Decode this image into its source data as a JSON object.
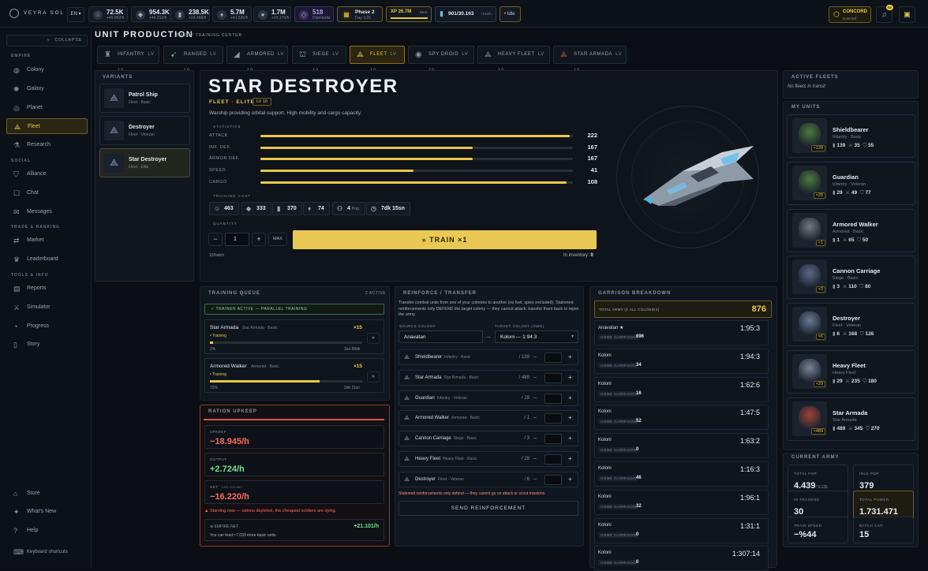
{
  "brand": "VEYRA SOL",
  "lang": "EN",
  "resources": [
    {
      "value": "72.5K",
      "rate": "+49.902/h",
      "icon": "people-icon"
    },
    {
      "value": "954.3K",
      "rate": "+46.212/h",
      "icon": "metal-icon"
    },
    {
      "value": "238.5K",
      "rate": "+24.468/h",
      "icon": "supply-icon"
    },
    {
      "value": "5.7M",
      "rate": "+41.536/h",
      "icon": "crystal-icon"
    },
    {
      "value": "1.7M",
      "rate": "+20.176/h",
      "icon": "food-icon"
    }
  ],
  "diamonds": {
    "value": "518",
    "label": "Diamonds"
  },
  "phase": {
    "title": "Phase 2",
    "sub": "Day 1/25"
  },
  "xp": {
    "value": "XP 26.7M",
    "max": "MAX",
    "fill": 1.0
  },
  "population": {
    "value": "901/30.163",
    "rate": "+144/h"
  },
  "idle": "Idle",
  "alliance": {
    "name": "CONCORD",
    "sub": "Concord"
  },
  "notif_count": "56",
  "sidebar": {
    "collapse": "COLLAPSE",
    "sections": [
      {
        "head": "EMPIRE",
        "items": [
          {
            "label": "Colony",
            "icon": "planet-icon"
          },
          {
            "label": "Galaxy",
            "icon": "galaxy-icon"
          },
          {
            "label": "Planet",
            "icon": "globe-icon"
          },
          {
            "label": "Fleet",
            "icon": "fleet-icon",
            "active": true
          },
          {
            "label": "Research",
            "icon": "flask-icon"
          }
        ]
      },
      {
        "head": "SOCIAL",
        "items": [
          {
            "label": "Alliance",
            "icon": "shield-icon"
          },
          {
            "label": "Chat",
            "icon": "chat-icon"
          },
          {
            "label": "Messages",
            "icon": "mail-icon"
          }
        ]
      },
      {
        "head": "TRADE & RANKING",
        "items": [
          {
            "label": "Market",
            "icon": "market-icon"
          },
          {
            "label": "Leaderboard",
            "icon": "trophy-icon"
          }
        ]
      },
      {
        "head": "TOOLS & INFO",
        "items": [
          {
            "label": "Reports",
            "icon": "report-icon"
          },
          {
            "label": "Simulator",
            "icon": "sim-icon"
          },
          {
            "label": "Progress",
            "icon": "progress-icon"
          },
          {
            "label": "Story",
            "icon": "book-icon"
          }
        ]
      }
    ],
    "bottom": [
      {
        "label": "Store",
        "icon": "store-icon"
      },
      {
        "label": "What's New",
        "icon": "news-icon"
      },
      {
        "label": "Help",
        "icon": "help-icon"
      },
      {
        "label": "Keyboard shortcuts",
        "icon": "keyboard-icon"
      }
    ]
  },
  "header": {
    "title": "UNIT PRODUCTION",
    "subtitle": "TROOP TRAINING CENTER"
  },
  "tabs": [
    {
      "label": "INFANTRY",
      "lv": "LV 10"
    },
    {
      "label": "RANGED",
      "lv": "LV 10"
    },
    {
      "label": "ARMORED",
      "lv": "LV 10"
    },
    {
      "label": "SIEGE",
      "lv": "LV 10"
    },
    {
      "label": "FLEET",
      "lv": "LV 10",
      "active": true
    },
    {
      "label": "SPY DROID",
      "lv": "LV 10"
    },
    {
      "label": "HEAVY FLEET",
      "lv": "LV 10"
    },
    {
      "label": "STAR ARMADA",
      "lv": "LV 10"
    }
  ],
  "variants_title": "VARIANTS",
  "variants": [
    {
      "name": "Patrol Ship",
      "sub": "Fleet · Basic"
    },
    {
      "name": "Destroyer",
      "sub": "Fleet · Veteran"
    },
    {
      "name": "Star Destroyer",
      "sub": "Fleet · Elite",
      "active": true
    }
  ],
  "unit": {
    "name": "STAR DESTROYER",
    "tag": "FLEET · ELITE",
    "lv": "LV 10",
    "desc": "Warship providing orbital support. High mobility and cargo capacity.",
    "stats_title": "STATISTICS",
    "stats": [
      {
        "label": "ATTACK",
        "value": "222",
        "fill": 0.99
      },
      {
        "label": "INF. DEF.",
        "value": "167",
        "fill": 0.68
      },
      {
        "label": "ARMOR DEF.",
        "value": "167",
        "fill": 0.68
      },
      {
        "label": "SPEED",
        "value": "41",
        "fill": 0.49
      },
      {
        "label": "CARGO",
        "value": "108",
        "fill": 0.98
      }
    ],
    "cost_title": "TRAINING COST",
    "costs": [
      {
        "value": "463",
        "icon": "people-icon"
      },
      {
        "value": "333",
        "icon": "metal-icon"
      },
      {
        "value": "370",
        "icon": "supply-icon"
      },
      {
        "value": "74",
        "icon": "crystal-icon"
      },
      {
        "value": "4",
        "suffix": "Pop.",
        "icon": "pop-icon"
      },
      {
        "value": "7dk 15sn",
        "icon": "clock-icon"
      }
    ],
    "qty_title": "QUANTITY",
    "qty": "1",
    "max": "MAX",
    "train": "TRAIN ×1",
    "batch": "15/batch",
    "inventory_label": "In inventory:",
    "inventory": "0"
  },
  "active_fleets": {
    "title": "ACTIVE FLEETS",
    "empty": "No fleets in transit"
  },
  "my_units": {
    "title": "MY UNITS",
    "items": [
      {
        "name": "Shieldbearer",
        "sub": "Infantry · Basic",
        "count": "×139",
        "a": "139",
        "b": "35",
        "c": "55"
      },
      {
        "name": "Guardian",
        "sub": "Infantry · Veteran",
        "count": "×29",
        "a": "29",
        "b": "49",
        "c": "77"
      },
      {
        "name": "Armored Walker",
        "sub": "Armored · Basic",
        "count": "×1",
        "a": "1",
        "b": "65",
        "c": "50"
      },
      {
        "name": "Cannon Carriage",
        "sub": "Siege · Basic",
        "count": "×3",
        "a": "3",
        "b": "110",
        "c": "80"
      },
      {
        "name": "Destroyer",
        "sub": "Fleet · Veteran",
        "count": "×6",
        "a": "6",
        "b": "168",
        "c": "126"
      },
      {
        "name": "Heavy Fleet",
        "sub": "Heavy Fleet",
        "count": "×29",
        "a": "29",
        "b": "235",
        "c": "180"
      },
      {
        "name": "Star Armada",
        "sub": "Star Armada",
        "count": "×489",
        "a": "489",
        "b": "345",
        "c": "270"
      }
    ]
  },
  "queue": {
    "title": "TRAINING QUEUE",
    "active": "2 ACTIVE",
    "banner": "TRAINER ACTIVE — PARALLEL TRAINING",
    "items": [
      {
        "name": "Star Armada",
        "sub": "Star Armada · Basic",
        "count": "×15",
        "status": "• Training",
        "pct": "2%",
        "fill": 0.02,
        "time": "3sa 58dk"
      },
      {
        "name": "Armored Walker",
        "sub": "Armored · Basic",
        "count": "×15",
        "status": "• Training",
        "pct": "72%",
        "fill": 0.72,
        "time": "2dk 11sn"
      }
    ]
  },
  "ration": {
    "title": "RATION UPKEEP",
    "upkeep_label": "UPKEEP",
    "upkeep": "−18.945/h",
    "output_label": "OUTPUT",
    "output": "+2.724/h",
    "net_label": "NET",
    "net_tag": "THIS COLONY",
    "net": "−16.220/h",
    "warning": "Starving now — rations depleted, the cheapest soldiers are dying.",
    "empire_label": "EMPIRE NET",
    "empire": "+21.101/h",
    "feed": "You can feed ≈7.033 more basic units"
  },
  "reinforce": {
    "title": "REINFORCE / TRANSFER",
    "desc": "Transfer combat units from one of your colonies to another (no fuel, spies excluded). Stationed reinforcements only DEFEND the target colony — they cannot attack; transfer them back to rejoin the army.",
    "source_label": "SOURCE COLONY",
    "source": "Anavatan",
    "target_label": "TARGET COLONY (OWN)",
    "target": "Koloni — 1:94:3",
    "rows": [
      {
        "name": "Shieldbearer",
        "sub": "Infantry · Basic",
        "count": "/ 139"
      },
      {
        "name": "Star Armada",
        "sub": "Star Armada · Basic",
        "count": "/ 489"
      },
      {
        "name": "Guardian",
        "sub": "Infantry · Veteran",
        "count": "/ 29"
      },
      {
        "name": "Armored Walker",
        "sub": "Armored · Basic",
        "count": "/ 1"
      },
      {
        "name": "Cannon Carriage",
        "sub": "Siege · Basic",
        "count": "/ 3"
      },
      {
        "name": "Heavy Fleet",
        "sub": "Heavy Fleet · Basic",
        "count": "/ 29"
      },
      {
        "name": "Destroyer",
        "sub": "Fleet · Veteran",
        "count": "/ 6"
      }
    ],
    "note": "Stationed reinforcements only defend — they cannot go on attack or scout missions.",
    "send": "SEND REINFORCEMENT"
  },
  "garrison": {
    "title": "GARRISON BREAKDOWN",
    "total_label": "TOTAL ARMY (Σ ALL COLONIES)",
    "total": "876",
    "hg": "HOME GARRISON",
    "rows": [
      {
        "name": "Anavatan ★",
        "coord": "1:95:3",
        "value": "696"
      },
      {
        "name": "Koloni",
        "coord": "1:94:3",
        "value": "34"
      },
      {
        "name": "Koloni",
        "coord": "1:62:6",
        "value": "16"
      },
      {
        "name": "Koloni",
        "coord": "1:47:5",
        "value": "52"
      },
      {
        "name": "Koloni",
        "coord": "1:63:2",
        "value": "0"
      },
      {
        "name": "Koloni",
        "coord": "1:16:3",
        "value": "46"
      },
      {
        "name": "Koloni",
        "coord": "1:96:1",
        "value": "32"
      },
      {
        "name": "Koloni",
        "coord": "1:31:1",
        "value": "0"
      },
      {
        "name": "Koloni",
        "coord": "1:307:14",
        "value": "0"
      }
    ]
  },
  "current_army": {
    "title": "CURRENT ARMY",
    "cells": [
      {
        "label": "TOTAL POP.",
        "value": "4.439",
        "extra": "/ 3.135"
      },
      {
        "label": "IDLE POP.",
        "value": "379"
      },
      {
        "label": "IN TRAINING",
        "value": "30"
      },
      {
        "label": "TOTAL POWER",
        "value": "1.731.471",
        "gold": true
      },
      {
        "label": "TRAIN SPEED",
        "value": "−%44"
      },
      {
        "label": "BATCH CAP.",
        "value": "15"
      }
    ]
  }
}
